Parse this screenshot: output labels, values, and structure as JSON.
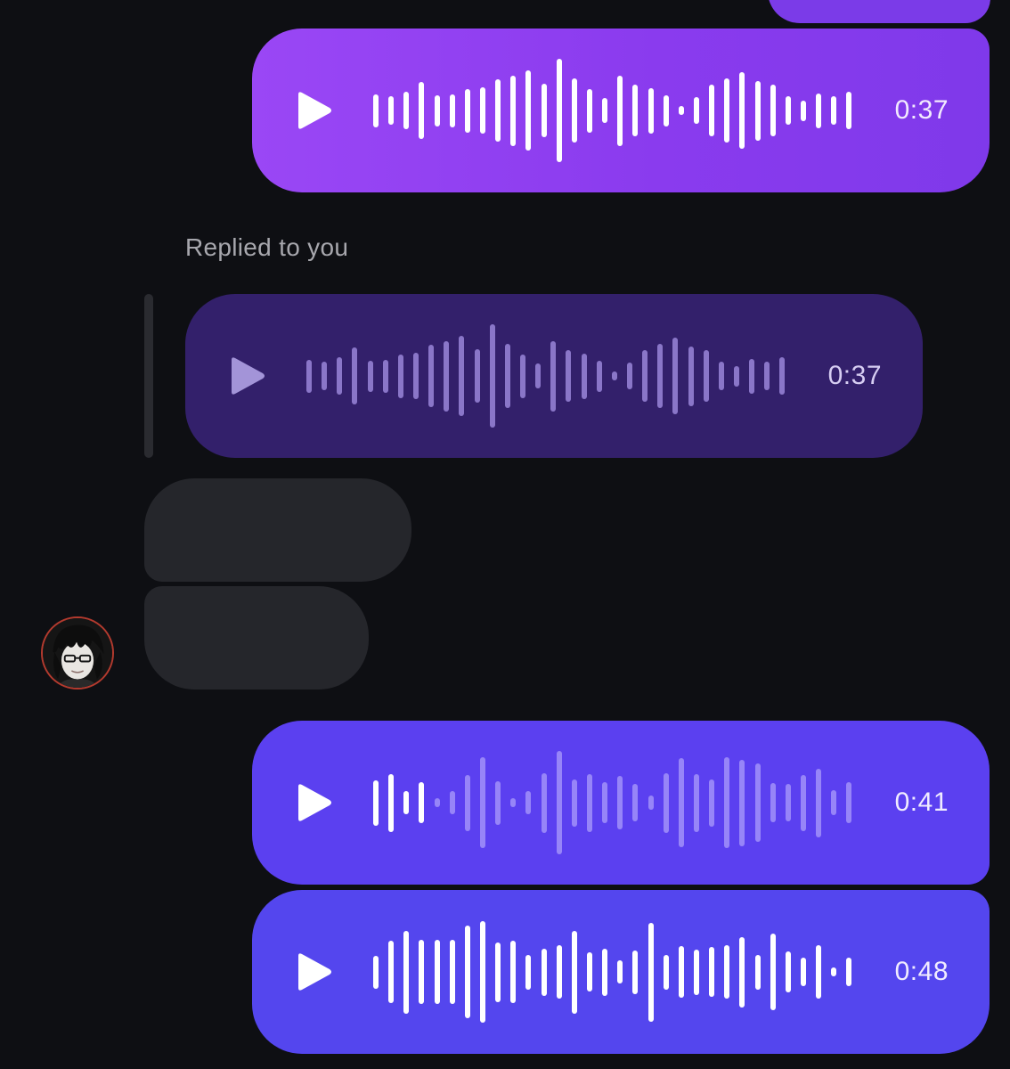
{
  "conversation": {
    "reply_label": "Replied to you",
    "colors": {
      "background": "#0e0f13",
      "outgoing_primary": "#8a3bee",
      "outgoing_blue": "#5b40f0",
      "quoted_background": "#33206b",
      "incoming_bubble": "#25262b"
    },
    "messages": [
      {
        "id": "msg-1",
        "type": "voice",
        "direction": "outgoing",
        "duration": "0:37",
        "play_icon": "play-icon",
        "playback_progress": 1.0,
        "waveform": [
          0.32,
          0.28,
          0.36,
          0.55,
          0.3,
          0.32,
          0.42,
          0.45,
          0.6,
          0.68,
          0.78,
          0.52,
          1.0,
          0.62,
          0.42,
          0.24,
          0.68,
          0.5,
          0.44,
          0.3,
          0.06,
          0.26,
          0.5,
          0.62,
          0.74,
          0.58,
          0.5,
          0.28,
          0.2,
          0.34,
          0.28,
          0.36
        ]
      },
      {
        "id": "quoted-msg",
        "type": "voice",
        "direction": "quoted",
        "duration": "0:37",
        "play_icon": "play-icon",
        "waveform": [
          0.32,
          0.28,
          0.36,
          0.55,
          0.3,
          0.32,
          0.42,
          0.45,
          0.6,
          0.68,
          0.78,
          0.52,
          1.0,
          0.62,
          0.42,
          0.24,
          0.68,
          0.5,
          0.44,
          0.3,
          0.06,
          0.26,
          0.5,
          0.62,
          0.74,
          0.58,
          0.5,
          0.28,
          0.2,
          0.34,
          0.28,
          0.36
        ]
      },
      {
        "id": "in-bubble-1",
        "type": "text",
        "direction": "incoming",
        "content": ""
      },
      {
        "id": "in-bubble-2",
        "type": "text",
        "direction": "incoming",
        "content": ""
      },
      {
        "id": "msg-3",
        "type": "voice",
        "direction": "outgoing",
        "duration": "0:41",
        "play_icon": "play-icon",
        "playback_progress": 0.1,
        "waveform": [
          0.44,
          0.56,
          0.22,
          0.4,
          0.06,
          0.22,
          0.54,
          0.88,
          0.42,
          0.06,
          0.22,
          0.58,
          1.0,
          0.46,
          0.56,
          0.4,
          0.52,
          0.36,
          0.14,
          0.58,
          0.86,
          0.56,
          0.46,
          0.88,
          0.84,
          0.76,
          0.38,
          0.36,
          0.54,
          0.66,
          0.24,
          0.4
        ]
      },
      {
        "id": "msg-4",
        "type": "voice",
        "direction": "outgoing",
        "duration": "0:48",
        "play_icon": "play-icon",
        "playback_progress": 1.0,
        "waveform": [
          0.32,
          0.6,
          0.8,
          0.62,
          0.62,
          0.62,
          0.9,
          0.98,
          0.58,
          0.6,
          0.34,
          0.46,
          0.52,
          0.8,
          0.38,
          0.46,
          0.22,
          0.42,
          0.96,
          0.34,
          0.5,
          0.44,
          0.48,
          0.52,
          0.68,
          0.34,
          0.74,
          0.4,
          0.28,
          0.52,
          0.08,
          0.28
        ]
      }
    ],
    "avatar": {
      "icon": "avatar-icon",
      "border_color": "#b33a2e"
    }
  }
}
